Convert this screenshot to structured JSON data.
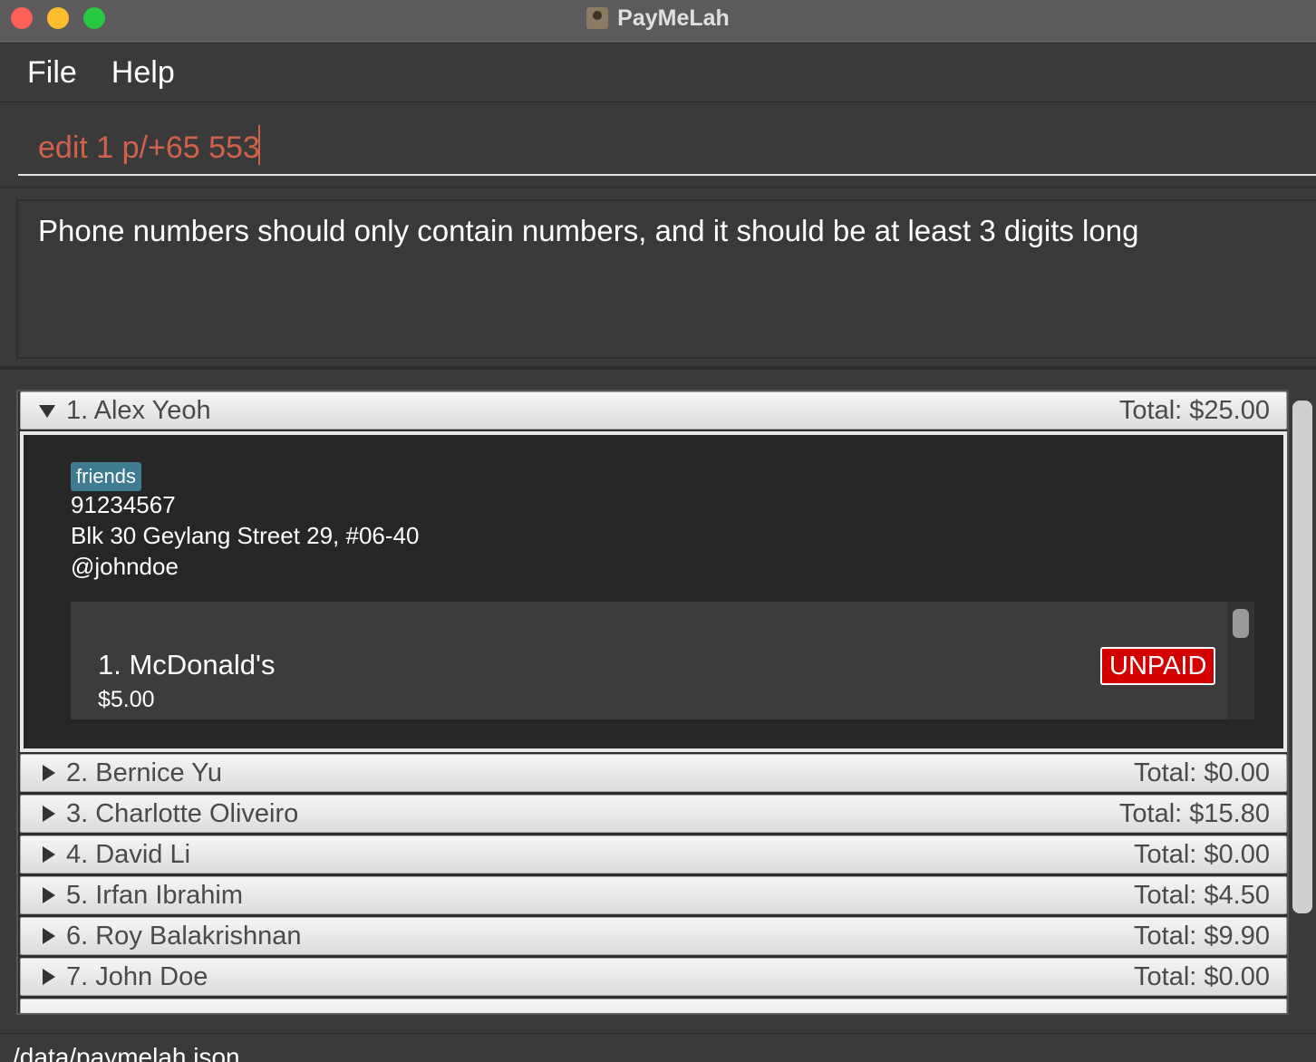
{
  "window": {
    "title": "PayMeLah"
  },
  "menu": {
    "items": [
      "File",
      "Help"
    ]
  },
  "command": {
    "value": "edit 1 p/+65 553"
  },
  "result": {
    "message": "Phone numbers should only contain numbers, and it should be at least 3 digits long"
  },
  "persons": [
    {
      "label": "1. Alex Yeoh",
      "total": "Total: $25.00",
      "expanded": true,
      "tag": "friends",
      "phone": "91234567",
      "address": "Blk 30 Geylang Street 29, #06-40",
      "telegram": "@johndoe",
      "debts": [
        {
          "title": "1.  McDonald's",
          "amount": "$5.00",
          "status": "UNPAID"
        }
      ]
    },
    {
      "label": "2. Bernice Yu",
      "total": "Total: $0.00"
    },
    {
      "label": "3. Charlotte Oliveiro",
      "total": "Total: $15.80"
    },
    {
      "label": "4. David Li",
      "total": "Total: $0.00"
    },
    {
      "label": "5. Irfan Ibrahim",
      "total": "Total: $4.50"
    },
    {
      "label": "6. Roy Balakrishnan",
      "total": "Total: $9.90"
    },
    {
      "label": "7. John Doe",
      "total": "Total: $0.00"
    }
  ],
  "status": {
    "path": "/data/paymelah.json"
  },
  "colors": {
    "error_text": "#d2614a",
    "tag": "#3e7b91",
    "unpaid": "#d40000"
  }
}
